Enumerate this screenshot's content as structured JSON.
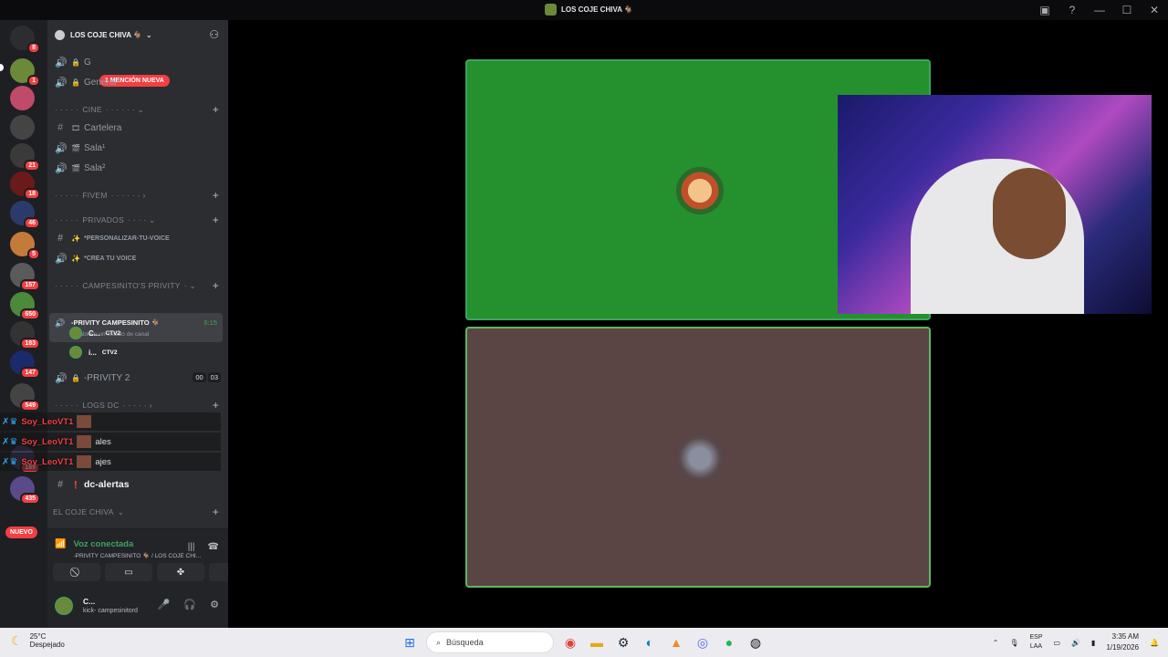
{
  "window": {
    "title": "LOS COJE CHIVA 🐐"
  },
  "servers": {
    "badges": [
      "8",
      "1",
      "21",
      "18",
      "46",
      "5",
      "157",
      "650",
      "183",
      "147",
      "549",
      "189",
      "435"
    ],
    "new_label": "NUEVO"
  },
  "guild": {
    "name": "LOS COJE CHIVA 🐐"
  },
  "channels": {
    "mention_banner": "1 MENCIÓN NUEVA",
    "general_first": "G",
    "general": "General³",
    "cat_cine": "CINE",
    "cartelera": "Cartelera",
    "sala1": "Sala¹",
    "sala2": "Sala²",
    "cat_fivem": "FIVEM",
    "cat_privados": "PRIVADOS",
    "personalizar": "*PERSONALIZAR-TU-VOICE",
    "crea_voice": "*CREA TU VOICE",
    "cat_campesinito": "CAMPESINITO'S PRIVITY",
    "active_name": "-PRIVITY CAMPESINITO 🐐",
    "active_time": "6:15",
    "active_status": "Establece un estado de canal",
    "voice_user1": "C...",
    "voice_user2": "i...",
    "voice_tag": "CTV2",
    "privity2": "-PRIVITY 2",
    "privity2_count_a": "00",
    "privity2_count_b": "03",
    "cat_logs": "LOGS DC",
    "dc_alertas": "dc-alertas",
    "cat_el_coje": "EL COJE CHIVA"
  },
  "overlay": {
    "user": "Soy_LeoVT1",
    "rows": [
      "",
      "ales",
      "ajes"
    ]
  },
  "voice_panel": {
    "status": "Voz conectada",
    "location": "-PRIVITY CAMPESINITO 🐐 / LOS COJE CHI..."
  },
  "user_panel": {
    "name": "C...",
    "status": "kick- campesinitord"
  },
  "taskbar": {
    "temp": "25°C",
    "weather": "Despejado",
    "search_placeholder": "Búsqueda",
    "lang1": "ESP",
    "lang2": "LAA",
    "time": "3:35 AM",
    "date": "1/19/2026"
  }
}
